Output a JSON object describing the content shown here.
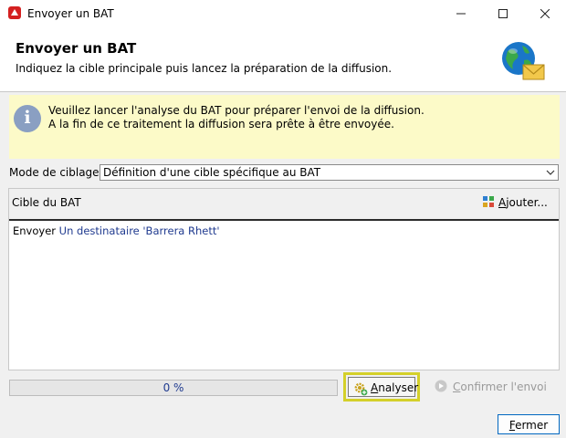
{
  "window": {
    "title": "Envoyer un BAT",
    "controls": [
      "minimize-icon",
      "maximize-icon",
      "close-icon"
    ]
  },
  "header": {
    "title": "Envoyer un BAT",
    "subtitle": "Indiquez la cible principale puis lancez la préparation de la diffusion.",
    "icon": "globe-mail-icon"
  },
  "info": {
    "icon": "info-icon",
    "line1": "Veuillez lancer l'analyse du BAT pour préparer l'envoi de la diffusion.",
    "line2": "A la fin de ce traitement la diffusion sera prête à être envoyée."
  },
  "mode": {
    "label": "Mode de ciblage :",
    "value": "Définition d'une cible spécifique au BAT"
  },
  "target": {
    "label": "Cible du BAT",
    "add_first": "A",
    "add_rest": "jouter...",
    "text_prefix": "Envoyer",
    "text_rest": " Un destinataire 'Barrera Rhett'"
  },
  "progress": {
    "value": 0,
    "label": "0 %"
  },
  "buttons": {
    "analyser_first": "A",
    "analyser_rest": "nalyser",
    "confirm_first": "C",
    "confirm_rest": "onfirmer l'envoi",
    "fermer_first": "F",
    "fermer_rest": "ermer"
  },
  "colors": {
    "info_bg": "#fcfac8",
    "highlight": "#d4d02a",
    "link_blue": "#1f3a8f"
  }
}
